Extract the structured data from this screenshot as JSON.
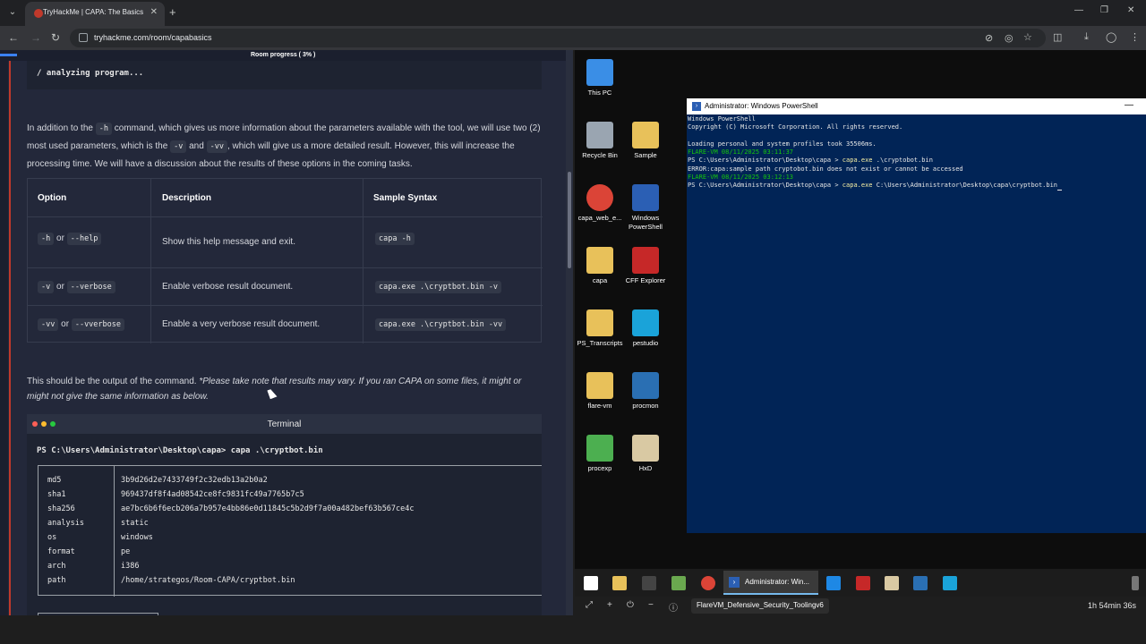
{
  "browser": {
    "tab_title": "TryHackMe | CAPA: The Basics",
    "url": "tryhackme.com/room/capabasics",
    "icons": [
      "chevron-down-icon",
      "close-icon",
      "plus-icon",
      "minimize-icon",
      "maximize-icon",
      "back-icon",
      "forward-icon",
      "reload-icon",
      "eye-off-icon",
      "star-icon",
      "extensions-icon",
      "download-icon",
      "profile-icon",
      "kebab-menu-icon"
    ]
  },
  "page": {
    "progress_label": "Room progress ( 3% )",
    "progress_value": 0.03,
    "code_top_line": "/ analyzing program...",
    "para1": {
      "a": "In addition to the ",
      "h": "-h",
      "b": " command, which gives us more information about the parameters available with the tool, we will use two (2) most used parameters, which is the ",
      "v": "-v",
      "c": " and ",
      "vv": "-vv",
      "d": ", which will give us a more detailed result. However, this will increase the processing time. We will have a discussion about the results of these options in the coming tasks."
    },
    "table": {
      "headers": [
        "Option",
        "Description",
        "Sample Syntax"
      ],
      "rows": [
        {
          "short": "-h",
          "or": "or",
          "long": "--help",
          "desc": "Show this help message and exit.",
          "syntax": "capa -h"
        },
        {
          "short": "-v",
          "or": "or",
          "long": "--verbose",
          "desc": "Enable verbose result document.",
          "syntax": "capa.exe .\\cryptbot.bin -v"
        },
        {
          "short": "-vv",
          "or": "or",
          "long": "--vverbose",
          "desc": "Enable a very verbose result document.",
          "syntax": "capa.exe .\\cryptbot.bin -vv"
        }
      ]
    },
    "para2": {
      "plain": "This should be the output of the command. ",
      "italic": "*Please take note that results may vary. If you ran CAPA on some files, it might or might not give the same information as below."
    },
    "terminal": {
      "title": "Terminal",
      "command": "PS C:\\Users\\Administrator\\Desktop\\capa> capa .\\cryptbot.bin",
      "rows": [
        {
          "key": "md5",
          "value": "3b9d26d2e7433749f2c32edb13a2b0a2"
        },
        {
          "key": "sha1",
          "value": "969437df8f4ad08542ce8fc9831fc49a7765b7c5"
        },
        {
          "key": "sha256",
          "value": "ae7bc6b6f6ecb206a7b957e4bb86e0d11845c5b2d9f7a00a482bef63b567ce4c"
        },
        {
          "key": "analysis",
          "value": "static"
        },
        {
          "key": "os",
          "value": "windows"
        },
        {
          "key": "format",
          "value": "pe"
        },
        {
          "key": "arch",
          "value": "i386"
        },
        {
          "key": "path",
          "value": "/home/strategos/Room-CAPA/cryptbot.bin"
        }
      ]
    }
  },
  "desktop": {
    "icons": [
      {
        "label": "This PC",
        "icon": "monitor-icon",
        "color": "#3a8ee6"
      },
      {
        "label": "Recycle Bin",
        "icon": "recycle-bin-icon",
        "color": "#9aa5b1"
      },
      {
        "label": "Sample",
        "icon": "folder-icon",
        "color": "#e8c15a"
      },
      {
        "label": "capa_web_e...",
        "icon": "chrome-icon",
        "color": "#db4437"
      },
      {
        "label": "Windows PowerShell",
        "icon": "powershell-icon",
        "color": "#2b5fb4"
      },
      {
        "label": "capa",
        "icon": "folder-icon",
        "color": "#e8c15a"
      },
      {
        "label": "CFF Explorer",
        "icon": "cff-explorer-icon",
        "color": "#c62828"
      },
      {
        "label": "PS_Transcripts",
        "icon": "folder-icon",
        "color": "#e8c15a"
      },
      {
        "label": "pestudio",
        "icon": "pestudio-icon",
        "color": "#1aa3d9"
      },
      {
        "label": "flare-vm",
        "icon": "folder-icon",
        "color": "#e8c15a"
      },
      {
        "label": "procmon",
        "icon": "procmon-icon",
        "color": "#2a6fb3"
      },
      {
        "label": "procexp",
        "icon": "procexp-icon",
        "color": "#4caf50"
      },
      {
        "label": "HxD",
        "icon": "hxd-icon",
        "color": "#d9c9a3"
      }
    ],
    "powershell": {
      "title": "Administrator: Windows PowerShell",
      "line1": "Windows PowerShell",
      "line2": "Copyright (C) Microsoft Corporation. All rights reserved.",
      "line3": "Loading personal and system profiles took 35506ms.",
      "line4": "FLARE-VM 08/11/2025 03:11:37",
      "line5_prompt": "PS C:\\Users\\Administrator\\Desktop\\capa > ",
      "line5_cmd": "capa.exe",
      "line5_arg": " .\\cryptobot.bin",
      "line6": "ERROR:capa:sample path cryptobot.bin does not exist or cannot be accessed",
      "line7": "FLARE-VM 08/11/2025 03:12:13",
      "line8_prompt": "PS C:\\Users\\Administrator\\Desktop\\capa > ",
      "line8_cmd": "capa.exe",
      "line8_arg": " C:\\Users\\Administrator\\Desktop\\capa\\cryptbot.bin"
    },
    "taskbar": {
      "active_label": "Administrator: Win...",
      "icons": [
        "windows-start-icon",
        "file-explorer-icon",
        "terminal-icon",
        "control-panel-icon",
        "chrome-icon",
        "powershell-icon",
        "edge-icon",
        "cff-explorer-icon",
        "hxd-icon",
        "procmon-icon",
        "pestudio-icon"
      ]
    },
    "rdp": {
      "vm_name": "FlareVM_Defensive_Security_Toolingv6",
      "timer": "1h 54min 36s"
    }
  }
}
